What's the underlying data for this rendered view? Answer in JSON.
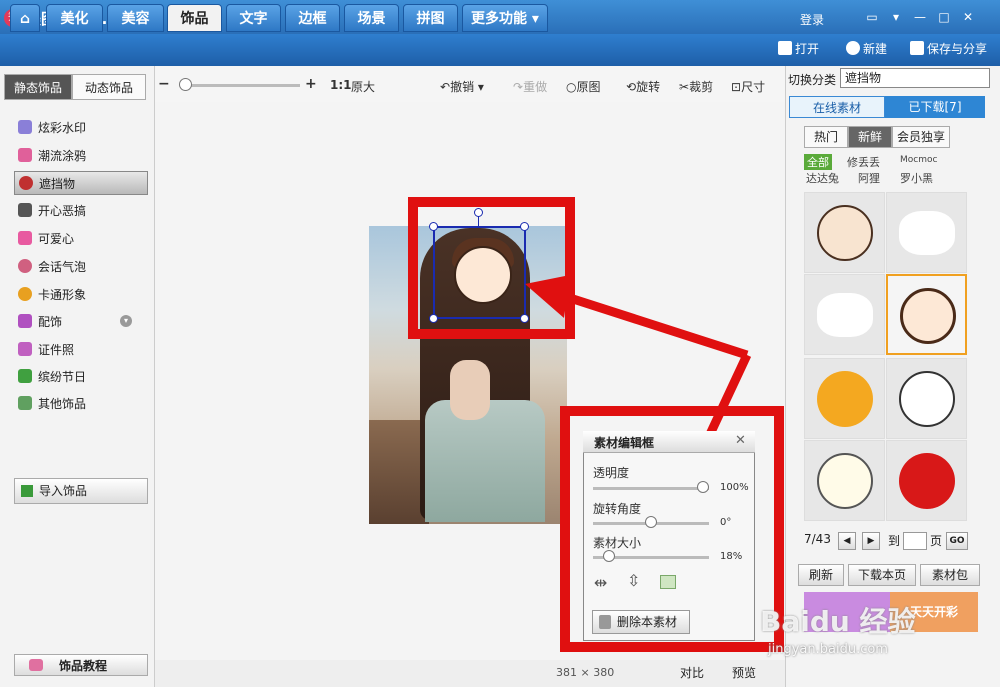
{
  "window": {
    "title": "美图秀秀 4.0.1",
    "login": "登录",
    "app_icon": "秀"
  },
  "nav": {
    "tabs": [
      "美化",
      "美容",
      "饰品",
      "文字",
      "边框",
      "场景",
      "拼图",
      "更多功能 ▾"
    ],
    "active_tab": "饰品",
    "actions": {
      "open": "打开",
      "new": "新建",
      "save_share": "保存与分享"
    }
  },
  "left": {
    "subtabs": [
      "静态饰品",
      "动态饰品"
    ],
    "categories": [
      {
        "label": "炫彩水印",
        "icon": "sparkle-icon",
        "color": "#8a7fd8"
      },
      {
        "label": "潮流涂鸦",
        "icon": "lips-icon",
        "color": "#e0609a"
      },
      {
        "label": "遮挡物",
        "icon": "face-mask-icon",
        "color": "#c03030"
      },
      {
        "label": "开心恶搞",
        "icon": "prank-icon",
        "color": "#555555"
      },
      {
        "label": "可爱心",
        "icon": "heart-icon",
        "color": "#e85aa0"
      },
      {
        "label": "会话气泡",
        "icon": "speech-bubble-icon",
        "color": "#d06080"
      },
      {
        "label": "卡通形象",
        "icon": "cartoon-icon",
        "color": "#e8a020"
      },
      {
        "label": "配饰",
        "icon": "bow-icon",
        "color": "#b050c0"
      },
      {
        "label": "证件照",
        "icon": "shirt-icon",
        "color": "#c060c0"
      },
      {
        "label": "缤纷节日",
        "icon": "gift-icon",
        "color": "#40a040"
      },
      {
        "label": "其他饰品",
        "icon": "star-icon",
        "color": "#60a060"
      }
    ],
    "import_label": "导入饰品",
    "tutorial_label": "饰品教程"
  },
  "toolbar": {
    "ratio": "1:1",
    "original_size": "原大",
    "undo": "撤销",
    "redo": "重做",
    "original": "原图",
    "rotate": "旋转",
    "crop": "裁剪",
    "size": "尺寸"
  },
  "editor": {
    "title": "素材编辑框",
    "opacity_label": "透明度",
    "opacity_value": "100%",
    "opacity_level": 1.0,
    "rotation_label": "旋转角度",
    "rotation_value": "0°",
    "rotation_level": 0.5,
    "size_label": "素材大小",
    "size_value": "18%",
    "size_level": 0.1,
    "delete_label": "删除本素材"
  },
  "status": {
    "dims": "381 × 380",
    "compare": "对比",
    "preview": "预览"
  },
  "right": {
    "switch_label": "切换分类",
    "switch_value": "遮挡物",
    "tabs": [
      "在线素材",
      "已下载[7]"
    ],
    "pills": [
      "热门",
      "新鲜",
      "会员独享"
    ],
    "active_pill": "新鲜",
    "filters": [
      "全部",
      "修丢丢",
      "Mocmoc",
      "达达兔",
      "阿狸",
      "罗小黑"
    ],
    "page_current": "7/43",
    "page_goto": "到",
    "page_unit": "页",
    "page_go": "GO",
    "buttons": [
      "刷新",
      "下载本页",
      "素材包"
    ],
    "banners": [
      "",
      "天天开彩"
    ]
  },
  "watermark": {
    "text": "Baidu 经验",
    "url": "jingyan.baidu.com"
  }
}
